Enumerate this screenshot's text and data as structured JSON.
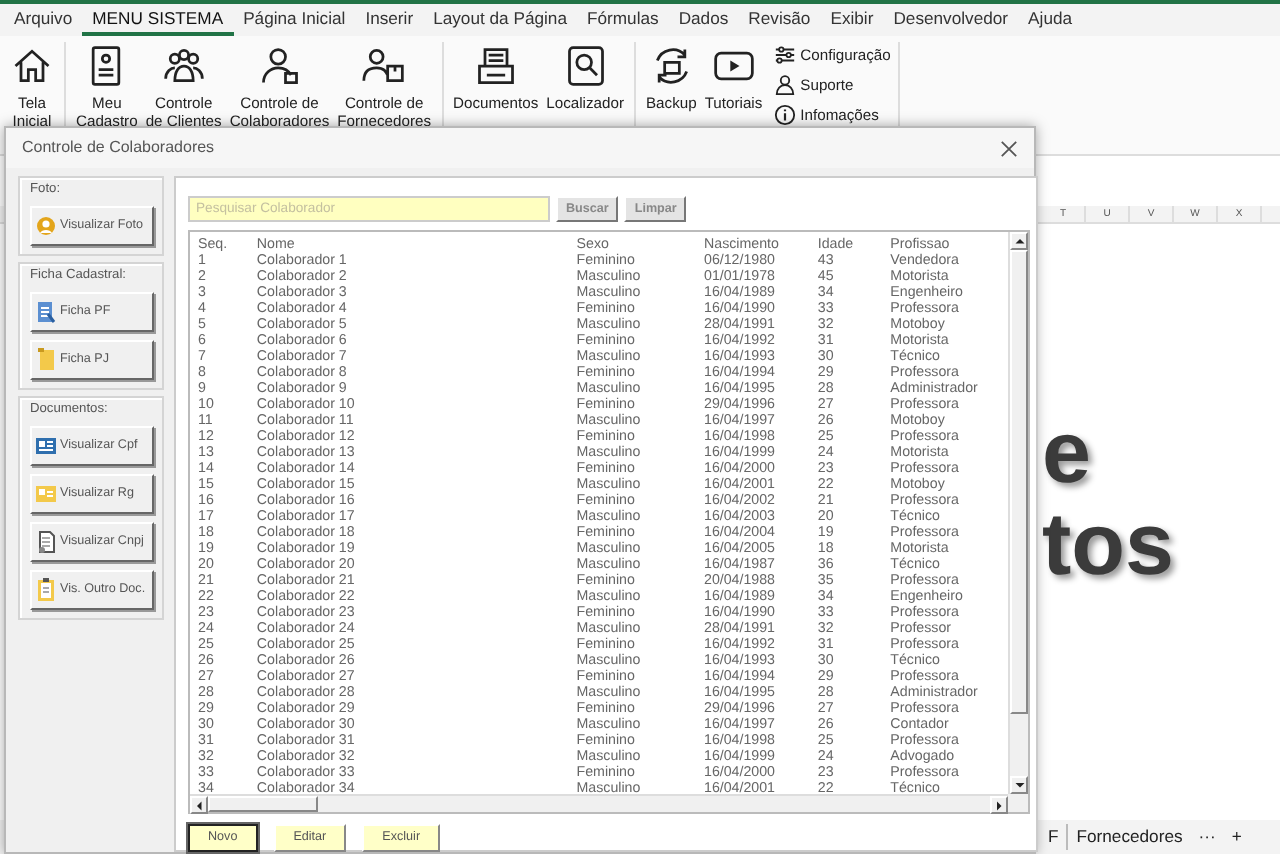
{
  "menu_tabs": [
    {
      "label": "Arquivo",
      "selected": false
    },
    {
      "label": "MENU SISTEMA",
      "selected": true
    },
    {
      "label": "Página Inicial",
      "selected": false
    },
    {
      "label": "Inserir",
      "selected": false
    },
    {
      "label": "Layout da Página",
      "selected": false
    },
    {
      "label": "Fórmulas",
      "selected": false
    },
    {
      "label": "Dados",
      "selected": false
    },
    {
      "label": "Revisão",
      "selected": false
    },
    {
      "label": "Exibir",
      "selected": false
    },
    {
      "label": "Desenvolvedor",
      "selected": false
    },
    {
      "label": "Ajuda",
      "selected": false
    }
  ],
  "ribbon": {
    "groups": [
      {
        "buttons": [
          {
            "lines": [
              "Tela",
              "Inicial"
            ]
          }
        ]
      },
      {
        "buttons": [
          {
            "lines": [
              "Meu",
              "Cadastro"
            ]
          },
          {
            "lines": [
              "Controle",
              "de Clientes"
            ]
          },
          {
            "lines": [
              "Controle de",
              "Colaboradores"
            ]
          },
          {
            "lines": [
              "Controle de",
              "Fornecedores"
            ]
          }
        ]
      },
      {
        "buttons": [
          {
            "lines": [
              "Documentos"
            ]
          },
          {
            "lines": [
              "Localizador"
            ]
          }
        ]
      },
      {
        "buttons": [
          {
            "lines": [
              "Backup"
            ]
          },
          {
            "lines": [
              "Tutoriais"
            ]
          }
        ],
        "small_buttons": [
          "Configuração",
          "Suporte",
          "Infomações"
        ]
      }
    ]
  },
  "sheet": {
    "column_headers": [
      "T",
      "U",
      "V",
      "W",
      "X"
    ],
    "shape_text": [
      "e",
      "tos"
    ],
    "sheet_tabs": [
      "F",
      "Fornecedores"
    ],
    "more_tabs": "···",
    "add_sheet": "+"
  },
  "dialog": {
    "title": "Controle de Colaboradores",
    "side_groups": [
      {
        "legend": "Foto:",
        "buttons": [
          "Visualizar Foto"
        ]
      },
      {
        "legend": "Ficha Cadastral:",
        "buttons": [
          "Ficha PF",
          "Ficha PJ"
        ]
      },
      {
        "legend": "Documentos:",
        "buttons": [
          "Visualizar Cpf",
          "Visualizar Rg",
          "Visualizar Cnpj",
          "Vis. Outro Doc."
        ]
      }
    ],
    "search": {
      "placeholder": "Pesquisar Colaborador"
    },
    "search_buttons": [
      "Buscar",
      "Limpar"
    ],
    "table": {
      "columns": [
        "Seq.",
        "Nome",
        "Sexo",
        "Nascimento",
        "Idade",
        "Profissao"
      ],
      "rows": [
        [
          "1",
          "Colaborador 1",
          "Feminino",
          "06/12/1980",
          "43",
          "Vendedora"
        ],
        [
          "2",
          "Colaborador 2",
          "Masculino",
          "01/01/1978",
          "45",
          "Motorista"
        ],
        [
          "3",
          "Colaborador 3",
          "Masculino",
          "16/04/1989",
          "34",
          "Engenheiro"
        ],
        [
          "4",
          "Colaborador 4",
          "Feminino",
          "16/04/1990",
          "33",
          "Professora"
        ],
        [
          "5",
          "Colaborador 5",
          "Masculino",
          "28/04/1991",
          "32",
          "Motoboy"
        ],
        [
          "6",
          "Colaborador 6",
          "Feminino",
          "16/04/1992",
          "31",
          "Motorista"
        ],
        [
          "7",
          "Colaborador 7",
          "Masculino",
          "16/04/1993",
          "30",
          "Técnico"
        ],
        [
          "8",
          "Colaborador 8",
          "Feminino",
          "16/04/1994",
          "29",
          "Professora"
        ],
        [
          "9",
          "Colaborador 9",
          "Masculino",
          "16/04/1995",
          "28",
          "Administrador"
        ],
        [
          "10",
          "Colaborador 10",
          "Feminino",
          "29/04/1996",
          "27",
          "Professora"
        ],
        [
          "11",
          "Colaborador 11",
          "Masculino",
          "16/04/1997",
          "26",
          "Motoboy"
        ],
        [
          "12",
          "Colaborador 12",
          "Feminino",
          "16/04/1998",
          "25",
          "Professora"
        ],
        [
          "13",
          "Colaborador 13",
          "Masculino",
          "16/04/1999",
          "24",
          "Motorista"
        ],
        [
          "14",
          "Colaborador 14",
          "Feminino",
          "16/04/2000",
          "23",
          "Professora"
        ],
        [
          "15",
          "Colaborador 15",
          "Masculino",
          "16/04/2001",
          "22",
          "Motoboy"
        ],
        [
          "16",
          "Colaborador 16",
          "Feminino",
          "16/04/2002",
          "21",
          "Professora"
        ],
        [
          "17",
          "Colaborador 17",
          "Masculino",
          "16/04/2003",
          "20",
          "Técnico"
        ],
        [
          "18",
          "Colaborador 18",
          "Feminino",
          "16/04/2004",
          "19",
          "Professora"
        ],
        [
          "19",
          "Colaborador 19",
          "Masculino",
          "16/04/2005",
          "18",
          "Motorista"
        ],
        [
          "20",
          "Colaborador 20",
          "Masculino",
          "16/04/1987",
          "36",
          "Técnico"
        ],
        [
          "21",
          "Colaborador 21",
          "Feminino",
          "20/04/1988",
          "35",
          "Professora"
        ],
        [
          "22",
          "Colaborador 22",
          "Masculino",
          "16/04/1989",
          "34",
          "Engenheiro"
        ],
        [
          "23",
          "Colaborador 23",
          "Feminino",
          "16/04/1990",
          "33",
          "Professora"
        ],
        [
          "24",
          "Colaborador 24",
          "Masculino",
          "28/04/1991",
          "32",
          "Professor"
        ],
        [
          "25",
          "Colaborador 25",
          "Feminino",
          "16/04/1992",
          "31",
          "Professora"
        ],
        [
          "26",
          "Colaborador 26",
          "Masculino",
          "16/04/1993",
          "30",
          "Técnico"
        ],
        [
          "27",
          "Colaborador 27",
          "Feminino",
          "16/04/1994",
          "29",
          "Professora"
        ],
        [
          "28",
          "Colaborador 28",
          "Masculino",
          "16/04/1995",
          "28",
          "Administrador"
        ],
        [
          "29",
          "Colaborador 29",
          "Feminino",
          "29/04/1996",
          "27",
          "Professora"
        ],
        [
          "30",
          "Colaborador 30",
          "Masculino",
          "16/04/1997",
          "26",
          "Contador"
        ],
        [
          "31",
          "Colaborador 31",
          "Feminino",
          "16/04/1998",
          "25",
          "Professora"
        ],
        [
          "32",
          "Colaborador 32",
          "Masculino",
          "16/04/1999",
          "24",
          "Advogado"
        ],
        [
          "33",
          "Colaborador 33",
          "Feminino",
          "16/04/2000",
          "23",
          "Professora"
        ],
        [
          "34",
          "Colaborador 34",
          "Masculino",
          "16/04/2001",
          "22",
          "Técnico"
        ]
      ]
    },
    "action_buttons": [
      {
        "label": "Novo",
        "focused": true
      },
      {
        "label": "Editar",
        "focused": false
      },
      {
        "label": "Excluir",
        "focused": false
      }
    ]
  }
}
